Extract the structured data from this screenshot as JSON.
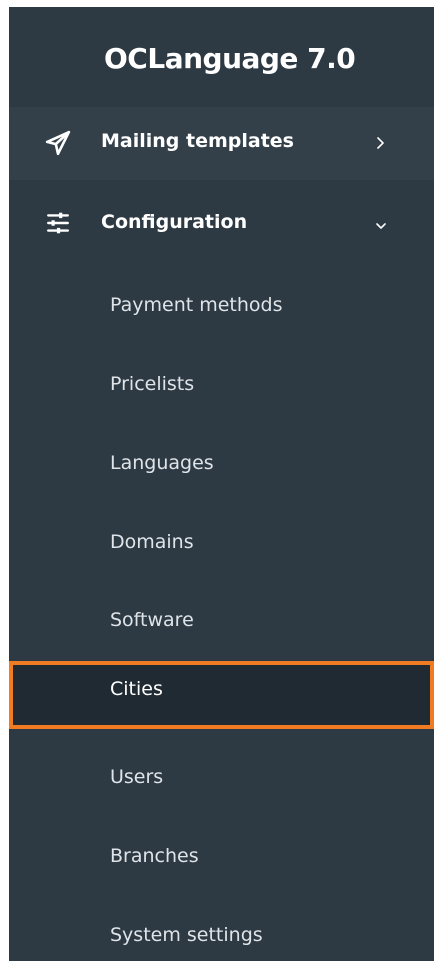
{
  "app": {
    "title": "OCLanguage 7.0"
  },
  "menu": {
    "mailing": {
      "label": "Mailing templates",
      "icon": "paper-plane-icon",
      "chevron": "chevron-right-icon"
    },
    "configuration": {
      "label": "Configuration",
      "icon": "sliders-icon",
      "chevron": "chevron-down-icon",
      "expanded": true
    }
  },
  "submenu": {
    "items": [
      {
        "label": "Payment methods"
      },
      {
        "label": "Pricelists"
      },
      {
        "label": "Languages"
      },
      {
        "label": "Domains"
      },
      {
        "label": "Software"
      },
      {
        "label": "Cities",
        "active": true
      },
      {
        "label": "Users"
      },
      {
        "label": "Branches"
      },
      {
        "label": "System settings"
      }
    ]
  },
  "colors": {
    "sidebar_bg": "#2d3943",
    "mailing_row_bg": "#333f49",
    "active_item_bg": "#202a32",
    "active_border": "#ef7b22",
    "text": "#ffffff"
  }
}
